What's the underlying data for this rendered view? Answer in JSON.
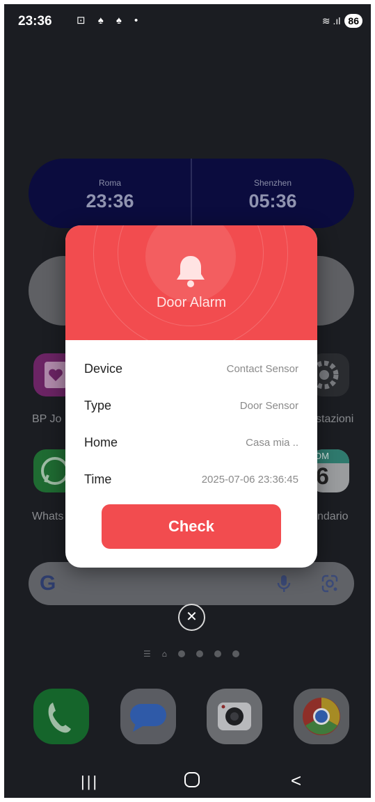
{
  "status_bar": {
    "time": "23:36",
    "notification_icons": "⊡ ♠ ♠ •",
    "signal": "≋ .ıl",
    "battery": "86"
  },
  "clock_widget": {
    "cities": [
      {
        "city": "Roma",
        "time": "23:36"
      },
      {
        "city": "Shenzhen",
        "time": "05:36"
      }
    ]
  },
  "apps": {
    "bp_label": "BP Jo",
    "settings_label": "stazioni",
    "whatsapp_label": "Whats",
    "calendar_label": "ndario",
    "calendar_month": "OM",
    "calendar_day": "6"
  },
  "search_bar": {
    "logo": "G"
  },
  "dialog": {
    "title": "Door Alarm",
    "icon": "bell-icon",
    "accent_color": "#f24c4f",
    "rows": [
      {
        "label": "Device",
        "value": "Contact Sensor"
      },
      {
        "label": "Type",
        "value": "Door Sensor"
      },
      {
        "label": "Home",
        "value": "Casa mia .."
      },
      {
        "label": "Time",
        "value": "2025-07-06 23:36:45"
      }
    ],
    "button_label": "Check"
  },
  "close_button": {
    "glyph": "✕"
  },
  "navigation": {
    "recent_glyph": "|||",
    "back_glyph": "<"
  }
}
